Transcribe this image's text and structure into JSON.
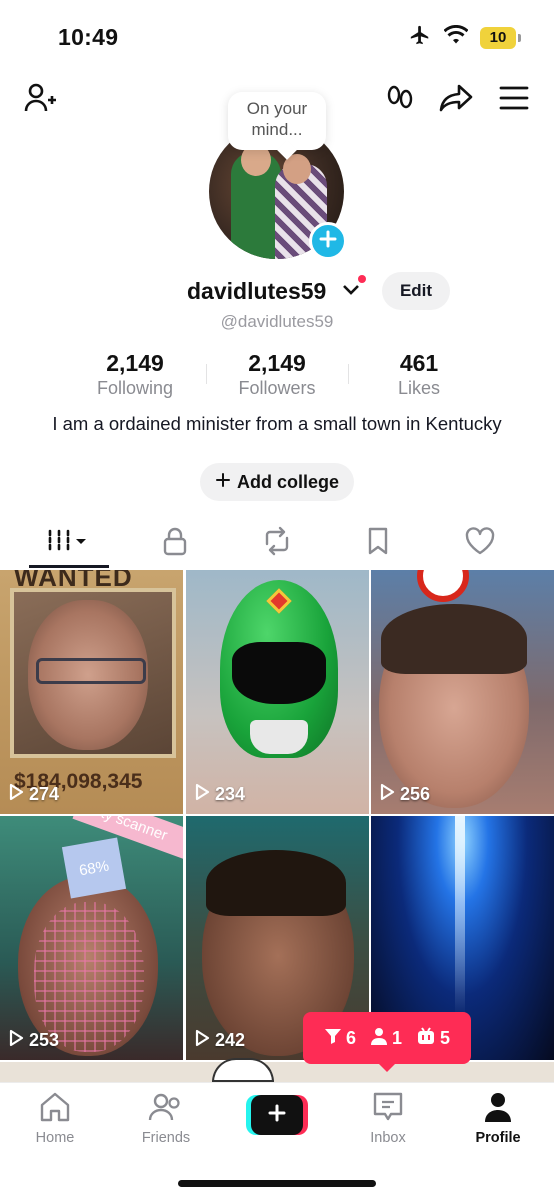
{
  "status_bar": {
    "time": "10:49",
    "battery": "10"
  },
  "profile": {
    "bubble_text": "On your mind...",
    "username": "davidlutes59",
    "handle": "@davidlutes59",
    "edit_label": "Edit",
    "bio": "I am a ordained minister from a small town in Kentucky",
    "add_college_label": "Add college"
  },
  "stats": [
    {
      "value": "2,149",
      "label": "Following"
    },
    {
      "value": "2,149",
      "label": "Followers"
    },
    {
      "value": "461",
      "label": "Likes"
    }
  ],
  "tabs": [
    {
      "name": "videos",
      "icon": "grid-icon"
    },
    {
      "name": "private",
      "icon": "lock-icon"
    },
    {
      "name": "reposts",
      "icon": "repost-icon"
    },
    {
      "name": "favorites",
      "icon": "bookmark-icon"
    },
    {
      "name": "liked",
      "icon": "heart-icon"
    }
  ],
  "videos": [
    {
      "views": "274",
      "overlay_title": "WANTED",
      "overlay_text": "$184,098,345"
    },
    {
      "views": "234"
    },
    {
      "views": "256"
    },
    {
      "views": "253",
      "overlay_title": "ty scanner",
      "overlay_text": "68%"
    },
    {
      "views": "242"
    },
    {
      "views": ""
    }
  ],
  "notifications": {
    "views": "6",
    "followers": "1",
    "comments": "5"
  },
  "bottom_nav": {
    "home": "Home",
    "friends": "Friends",
    "inbox": "Inbox",
    "profile": "Profile"
  },
  "colors": {
    "accent": "#fe2c55",
    "cyan": "#25f4ee",
    "add_blue": "#20b8e6"
  }
}
